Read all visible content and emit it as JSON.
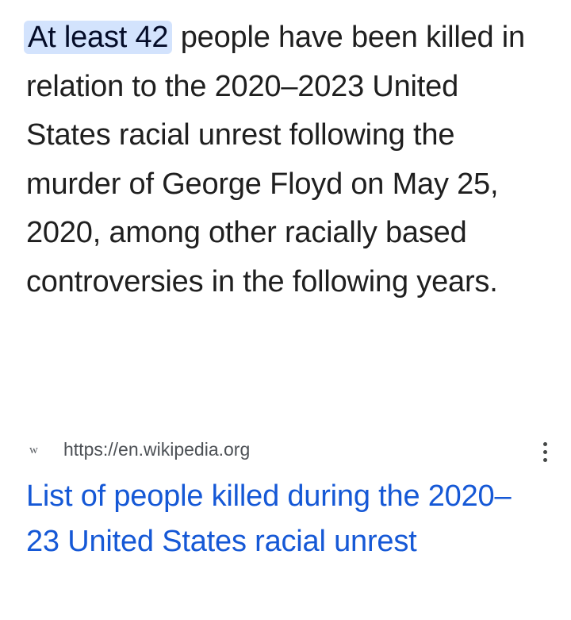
{
  "snippet": {
    "highlight": "At least 42",
    "text": " people have been killed in relation to the 2020–2023 United States racial unrest following the murder of George Floyd on May 25, 2020, among other racially based controversies in the following years."
  },
  "source": {
    "favicon": "w",
    "url": "https://en.wikipedia.org"
  },
  "result": {
    "title": "List of people killed during the 2020–23 United States racial unrest"
  },
  "icons": {
    "more": "more-vert-icon"
  },
  "colors": {
    "highlight_bg": "#d3e3fd",
    "link": "#1558d6",
    "text": "#1f1f1f",
    "url": "#4d5156"
  }
}
